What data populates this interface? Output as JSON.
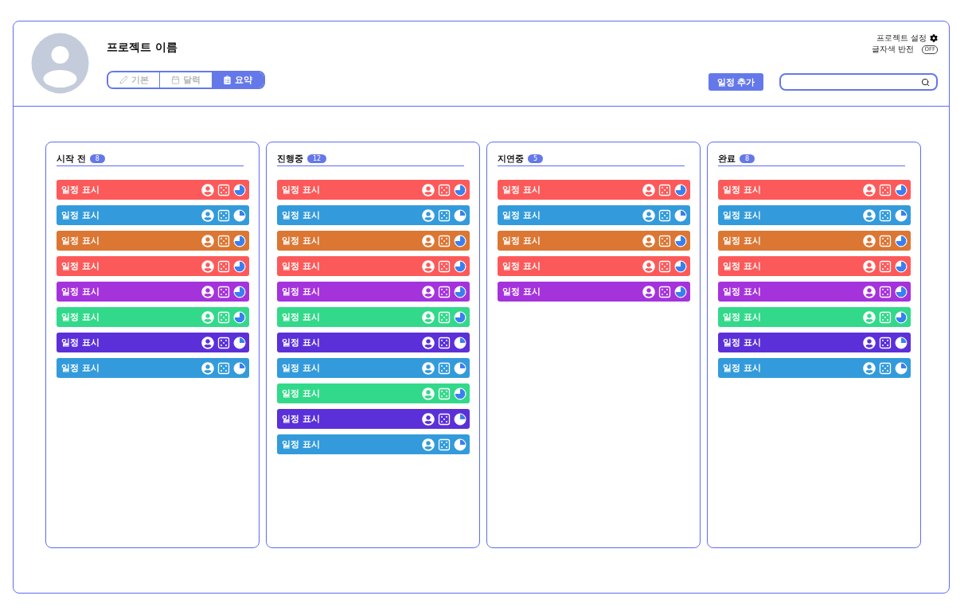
{
  "project": {
    "name": "프로젝트 이름"
  },
  "tabs": [
    {
      "label": "기본",
      "selected": false
    },
    {
      "label": "달력",
      "selected": false
    },
    {
      "label": "요약",
      "selected": true
    }
  ],
  "settings": {
    "label": "프로젝트 설정"
  },
  "invert": {
    "label": "글자색 반전",
    "on": false,
    "switch_text": "OFF"
  },
  "add_button": "일정 추가",
  "columns": [
    {
      "title": "시작 전",
      "count": "8",
      "cards": [
        {
          "label": "일정 표시",
          "color": "#fc5a5a",
          "kind": "threequarter"
        },
        {
          "label": "일정 표시",
          "color": "#339bdb",
          "kind": "quarter"
        },
        {
          "label": "일정 표시",
          "color": "#dc7633",
          "kind": "threequarter"
        },
        {
          "label": "일정 표시",
          "color": "#fc5a5a",
          "kind": "threequarter"
        },
        {
          "label": "일정 표시",
          "color": "#a533dc",
          "kind": "threequarter"
        },
        {
          "label": "일정 표시",
          "color": "#33d98a",
          "kind": "threequarter"
        },
        {
          "label": "일정 표시",
          "color": "#5b30d9",
          "kind": "quarter"
        },
        {
          "label": "일정 표시",
          "color": "#339bdb",
          "kind": "quarter"
        }
      ]
    },
    {
      "title": "진행중",
      "count": "12",
      "cards": [
        {
          "label": "일정 표시",
          "color": "#fc5a5a",
          "kind": "threequarter"
        },
        {
          "label": "일정 표시",
          "color": "#339bdb",
          "kind": "quarter"
        },
        {
          "label": "일정 표시",
          "color": "#dc7633",
          "kind": "threequarter"
        },
        {
          "label": "일정 표시",
          "color": "#fc5a5a",
          "kind": "threequarter"
        },
        {
          "label": "일정 표시",
          "color": "#a533dc",
          "kind": "threequarter"
        },
        {
          "label": "일정 표시",
          "color": "#33d98a",
          "kind": "threequarter"
        },
        {
          "label": "일정 표시",
          "color": "#5b30d9",
          "kind": "quarter"
        },
        {
          "label": "일정 표시",
          "color": "#339bdb",
          "kind": "quarter"
        },
        {
          "label": "일정 표시",
          "color": "#33d98a",
          "kind": "threequarter"
        },
        {
          "label": "일정 표시",
          "color": "#5b30d9",
          "kind": "quarter"
        },
        {
          "label": "일정 표시",
          "color": "#339bdb",
          "kind": "quarter"
        }
      ]
    },
    {
      "title": "지연중",
      "count": "5",
      "cards": [
        {
          "label": "일정 표시",
          "color": "#fc5a5a",
          "kind": "threequarter"
        },
        {
          "label": "일정 표시",
          "color": "#339bdb",
          "kind": "quarter"
        },
        {
          "label": "일정 표시",
          "color": "#dc7633",
          "kind": "threequarter"
        },
        {
          "label": "일정 표시",
          "color": "#fc5a5a",
          "kind": "threequarter"
        },
        {
          "label": "일정 표시",
          "color": "#a533dc",
          "kind": "threequarter"
        }
      ]
    },
    {
      "title": "완료",
      "count": "8",
      "cards": [
        {
          "label": "일정 표시",
          "color": "#fc5a5a",
          "kind": "threequarter"
        },
        {
          "label": "일정 표시",
          "color": "#339bdb",
          "kind": "quarter"
        },
        {
          "label": "일정 표시",
          "color": "#dc7633",
          "kind": "threequarter"
        },
        {
          "label": "일정 표시",
          "color": "#fc5a5a",
          "kind": "threequarter"
        },
        {
          "label": "일정 표시",
          "color": "#a533dc",
          "kind": "threequarter"
        },
        {
          "label": "일정 표시",
          "color": "#33d98a",
          "kind": "threequarter"
        },
        {
          "label": "일정 표시",
          "color": "#5b30d9",
          "kind": "quarter"
        },
        {
          "label": "일정 표시",
          "color": "#339bdb",
          "kind": "quarter"
        }
      ]
    }
  ]
}
